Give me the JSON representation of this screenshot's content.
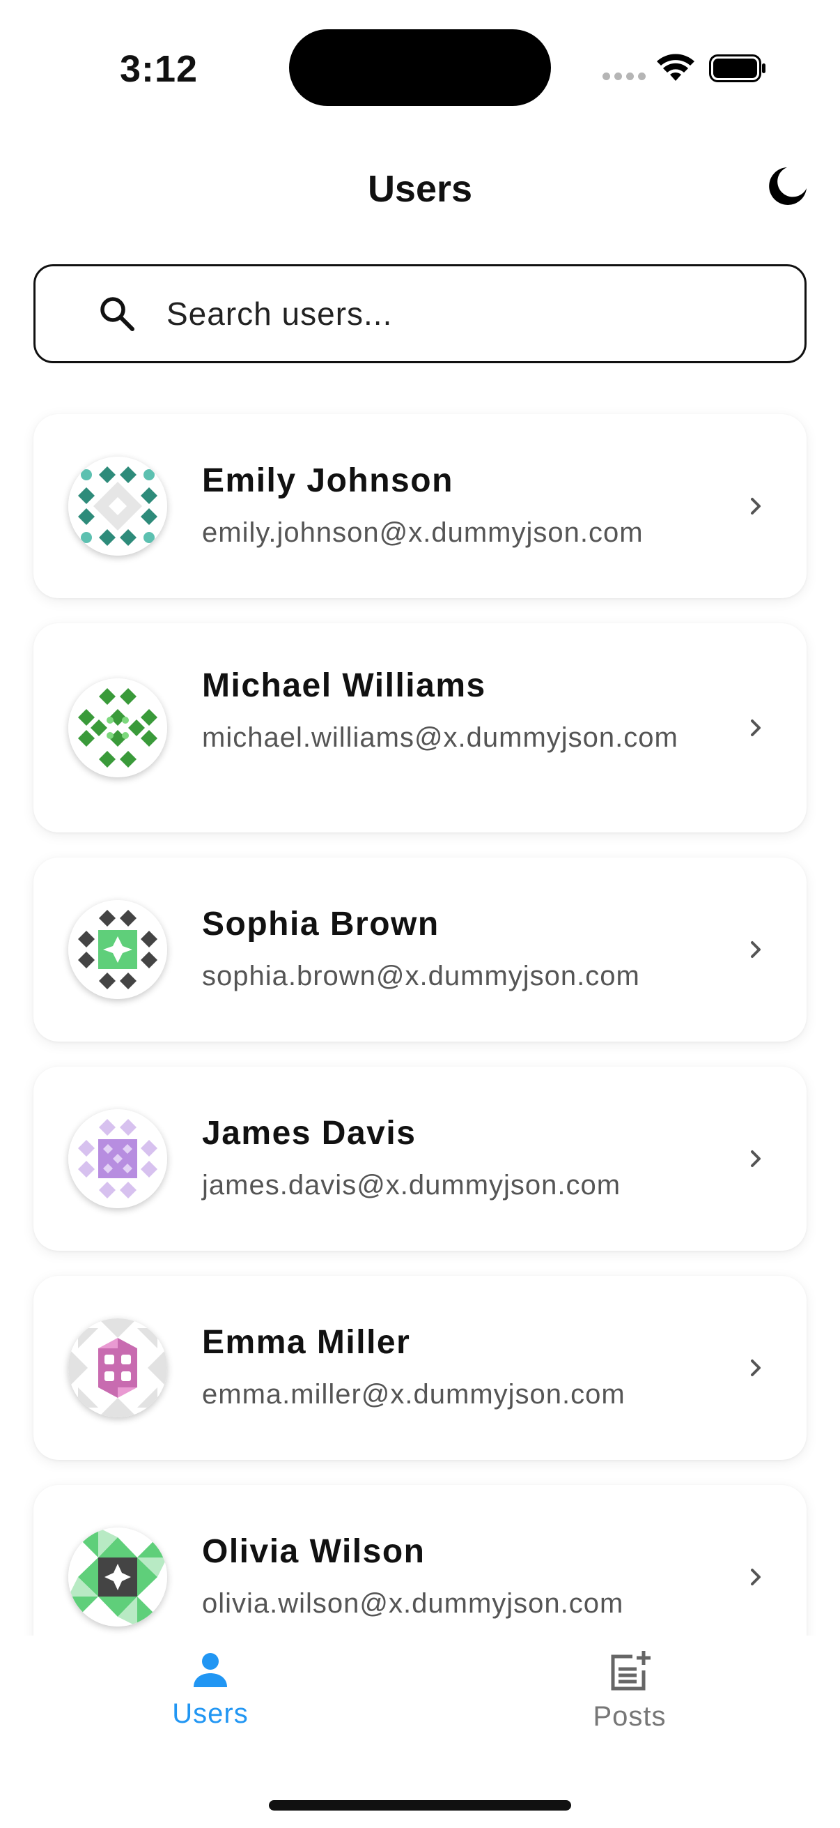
{
  "status_bar": {
    "time": "3:12"
  },
  "header": {
    "title": "Users",
    "theme_icon": "moon-icon"
  },
  "search": {
    "placeholder": "Search users...",
    "value": ""
  },
  "users": [
    {
      "name": "Emily Johnson",
      "email": "emily.johnson@x.dummyjson.com"
    },
    {
      "name": "Michael Williams",
      "email": "michael.williams@x.dummyjson.com"
    },
    {
      "name": "Sophia Brown",
      "email": "sophia.brown@x.dummyjson.com"
    },
    {
      "name": "James Davis",
      "email": "james.davis@x.dummyjson.com"
    },
    {
      "name": "Emma Miller",
      "email": "emma.miller@x.dummyjson.com"
    },
    {
      "name": "Olivia Wilson",
      "email": "olivia.wilson@x.dummyjson.com"
    }
  ],
  "bottom_nav": {
    "active": "Users",
    "items": [
      {
        "label": "Users",
        "icon": "person-icon"
      },
      {
        "label": "Posts",
        "icon": "post-add-icon"
      }
    ]
  },
  "colors": {
    "accent": "#2196F3",
    "inactive": "#777777",
    "avatar_teal": "#2E8B7A",
    "avatar_green": "#3A9A3A",
    "avatar_dark": "#444444",
    "avatar_purple": "#7B4DC0",
    "avatar_pink": "#C86BB0"
  }
}
